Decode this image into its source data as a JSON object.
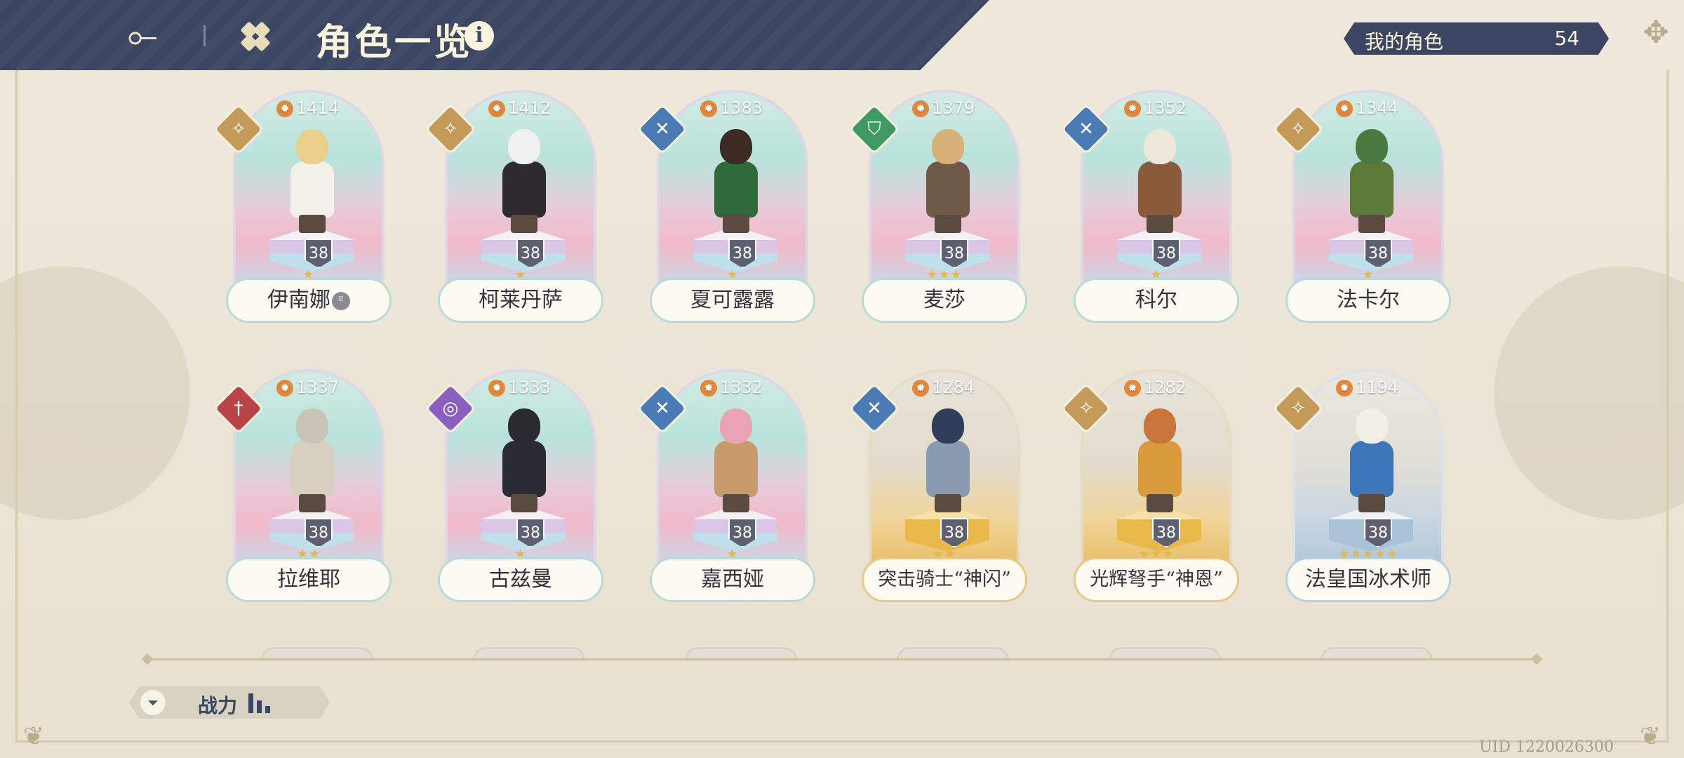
{
  "header": {
    "title": "角色一览",
    "info_icon": "i",
    "my_characters_label": "我的角色",
    "my_characters_count": "54"
  },
  "icons": {
    "back": "back-arrow-icon",
    "grid": "grid-view-icon",
    "settings": "settings-icon",
    "filter": "filter-icon",
    "flame": "flame-icon"
  },
  "characters": [
    {
      "name": "伊南娜",
      "power": "1414",
      "level": "38",
      "stars": "★",
      "class": "gold",
      "frame": "rainbow",
      "ex_mark": "ᴱ"
    },
    {
      "name": "柯莱丹萨",
      "power": "1412",
      "level": "38",
      "stars": "★",
      "class": "gold",
      "frame": "rainbow"
    },
    {
      "name": "夏可露露",
      "power": "1383",
      "level": "38",
      "stars": "★",
      "class": "blue",
      "frame": "rainbow"
    },
    {
      "name": "麦莎",
      "power": "1379",
      "level": "38",
      "stars": "★★★",
      "class": "green",
      "frame": "rainbow"
    },
    {
      "name": "科尔",
      "power": "1352",
      "level": "38",
      "stars": "★",
      "class": "blue",
      "frame": "rainbow"
    },
    {
      "name": "法卡尔",
      "power": "1344",
      "level": "38",
      "stars": "★",
      "class": "gold",
      "frame": "rainbow"
    },
    {
      "name": "拉维耶",
      "power": "1337",
      "level": "38",
      "stars": "★★",
      "class": "red",
      "frame": "rainbow"
    },
    {
      "name": "古兹曼",
      "power": "1333",
      "level": "38",
      "stars": "★",
      "class": "purple",
      "frame": "rainbow"
    },
    {
      "name": "嘉西娅",
      "power": "1332",
      "level": "38",
      "stars": "★",
      "class": "blue",
      "frame": "rainbow"
    },
    {
      "name": "突击骑士“神闪”",
      "power": "1284",
      "level": "38",
      "stars": "★★",
      "class": "blue",
      "frame": "gold"
    },
    {
      "name": "光辉弩手“神恩”",
      "power": "1282",
      "level": "38",
      "stars": "★★★",
      "class": "gold",
      "frame": "gold"
    },
    {
      "name": "法皇国冰术师",
      "power": "1194",
      "level": "38",
      "stars": "★★★★★",
      "class": "gold",
      "frame": "silver"
    }
  ],
  "sort": {
    "label": "战力"
  },
  "footer": {
    "uid": "UID 1220026300"
  },
  "colors": {
    "header_bg": "#3b4762",
    "page_bg": "#ece6d8",
    "class_gold": "#c39a58",
    "class_blue": "#4a7bb5",
    "class_green": "#3e9a62",
    "class_red": "#b84446",
    "class_purple": "#8a5fc0"
  }
}
